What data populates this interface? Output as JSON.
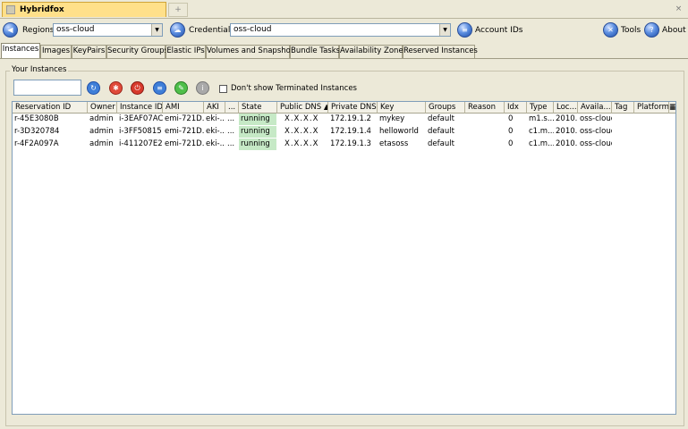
{
  "window": {
    "tab_title": "Hybridfox",
    "new_tab": "+",
    "close": "×"
  },
  "toolbar": {
    "regions_label": "Regions",
    "regions_value": "oss-cloud",
    "credentials_label": "Credentials",
    "credentials_value": "oss-cloud",
    "account_ids_label": "Account IDs",
    "tools_label": "Tools",
    "about_label": "About"
  },
  "tabs": [
    "Instances",
    "Images",
    "KeyPairs",
    "Security Groups",
    "Elastic IPs",
    "Volumes and Snapshots",
    "Bundle Tasks",
    "Availability Zones",
    "Reserved Instances"
  ],
  "instances": {
    "group_title": "Your Instances",
    "search_value": "",
    "checkbox_label": "Don't show Terminated Instances",
    "columns": [
      "Reservation ID",
      "Owner",
      "Instance ID",
      "AMI",
      "AKI",
      "...",
      "State",
      "Public DNS ▲",
      "Private DNS",
      "Key",
      "Groups",
      "Reason",
      "Idx",
      "Type",
      "Loc...",
      "Availa...",
      "Tag",
      "Platform",
      "▦"
    ],
    "rows": [
      [
        "r-45E3080B",
        "admin",
        "i-3EAF07AC",
        "emi-721D...",
        "eki-...",
        "...",
        "running",
        "X.X.X.X",
        "172.19.1.2",
        "mykey",
        "default",
        "",
        "0",
        "m1.s...",
        "2010...",
        "oss-cloud",
        "",
        ""
      ],
      [
        "r-3D320784",
        "admin",
        "i-3FF50815",
        "emi-721D...",
        "eki-...",
        "...",
        "running",
        "X.X.X.X",
        "172.19.1.4",
        "helloworld",
        "default",
        "",
        "0",
        "c1.m...",
        "2010...",
        "oss-cloud",
        "",
        ""
      ],
      [
        "r-4F2A097A",
        "admin",
        "i-411207E2",
        "emi-721D...",
        "eki-...",
        "...",
        "running",
        "X.X.X.X",
        "172.19.1.3",
        "etasoss",
        "default",
        "",
        "0",
        "c1.m...",
        "2010...",
        "oss-cloud",
        "",
        ""
      ]
    ]
  },
  "colors": {
    "tab_active": "#ffe08a",
    "running": "#c6e9c6",
    "accent": "#2a5cb8"
  }
}
